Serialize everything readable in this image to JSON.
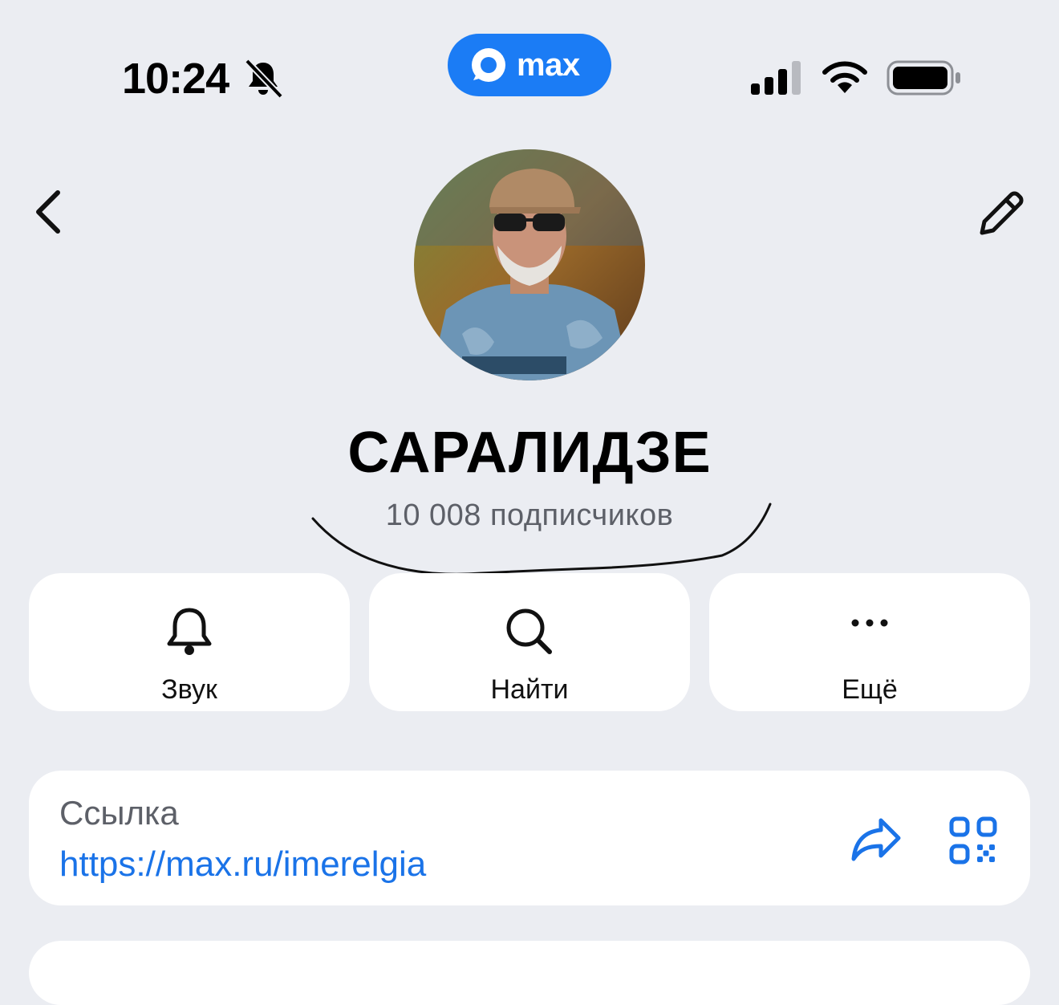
{
  "status_bar": {
    "time": "10:24",
    "icons": [
      "bell-slash-icon",
      "cellular-signal-icon",
      "wifi-icon",
      "battery-icon"
    ]
  },
  "app_badge": {
    "label": "max",
    "color": "#1b7cf5"
  },
  "nav": {
    "back_icon": "chevron-left-icon",
    "edit_icon": "pencil-icon"
  },
  "profile": {
    "name": "САРАЛИДЗЕ",
    "subscribers": "10 008 подписчиков",
    "avatar_icon": "channel-avatar-photo"
  },
  "actions": [
    {
      "label": "Звук",
      "icon": "bell-icon"
    },
    {
      "label": "Найти",
      "icon": "search-icon"
    },
    {
      "label": "Ещё",
      "icon": "more-horizontal-icon"
    }
  ],
  "link_card": {
    "title": "Ссылка",
    "url": "https://max.ru/imerelgia",
    "icons": [
      "share-icon",
      "qr-code-icon"
    ]
  },
  "colors": {
    "background": "#ebedf2",
    "accent": "#1a73e8",
    "card": "#ffffff",
    "secondary_text": "#5d6068"
  }
}
